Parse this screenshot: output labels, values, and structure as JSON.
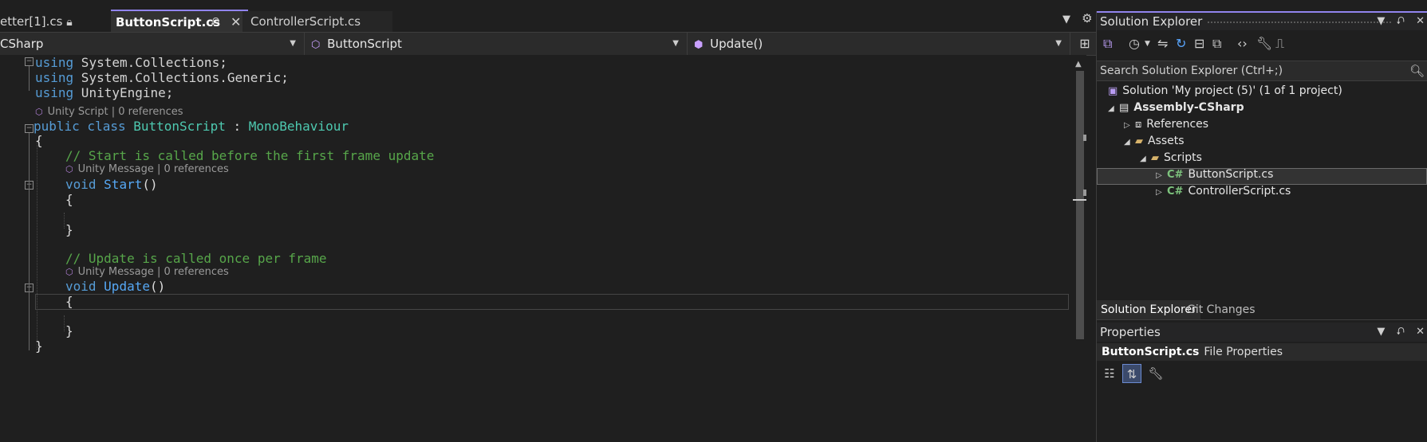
{
  "tabs": [
    {
      "label": "etter[1].cs",
      "icon": "lock-icon"
    },
    {
      "label": "ButtonScript.cs",
      "active": true
    },
    {
      "label": "ControllerScript.cs"
    }
  ],
  "navbar": {
    "project": "CSharp",
    "type": "ButtonScript",
    "member": "Update()"
  },
  "code": {
    "lines": [
      {
        "a": "using",
        "b": " System.Collections;"
      },
      {
        "a": "using",
        "b": " System.Collections.Generic;"
      },
      {
        "a": "using",
        "b": " UnityEngine;"
      }
    ],
    "lens_class": "Unity Script | 0 references",
    "class_decl": {
      "kw": "public class",
      "name": "ButtonScript",
      "sep": " : ",
      "base": "MonoBehaviour"
    },
    "open_brace": "{",
    "close_brace": "}",
    "comment_start": "// Start is called before the first frame update",
    "lens_start": "Unity Message | 0 references",
    "start_decl": {
      "kw": "void",
      "name": "Start",
      "parens": "()"
    },
    "comment_update": "// Update is called once per frame",
    "lens_update": "Unity Message | 0 references",
    "update_decl": {
      "kw": "void",
      "name": "Update",
      "parens": "()"
    }
  },
  "solution_explorer": {
    "title": "Solution Explorer",
    "search_placeholder": "Search Solution Explorer (Ctrl+;)",
    "tree": [
      {
        "label": "Solution 'My project (5)' (1 of 1 project)"
      },
      {
        "label": "Assembly-CSharp"
      },
      {
        "label": "References"
      },
      {
        "label": "Assets"
      },
      {
        "label": "Scripts"
      },
      {
        "label": "ButtonScript.cs"
      },
      {
        "label": "ControllerScript.cs"
      }
    ],
    "bottom_tabs": [
      "Solution Explorer",
      "Git Changes"
    ]
  },
  "properties": {
    "title": "Properties",
    "object_name": "ButtonScript.cs",
    "object_kind": "File Properties"
  },
  "colors": {
    "accent": "#9184ee",
    "keyword": "#569cd6",
    "type": "#4ec9b0",
    "comment": "#57a64a"
  }
}
